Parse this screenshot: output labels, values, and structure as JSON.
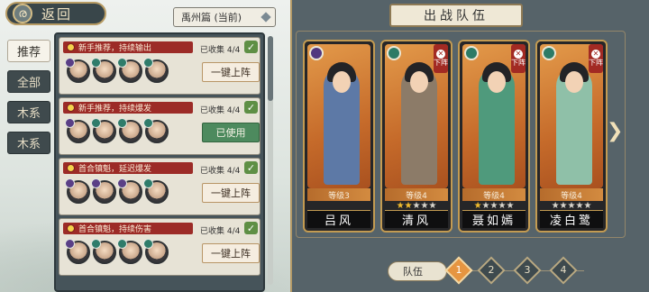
{
  "topbar": {
    "back_label": "返回",
    "chapter": "禹州篇 (当前)"
  },
  "tabs": [
    {
      "label": "推荐",
      "active": true
    },
    {
      "label": "全部",
      "active": false
    },
    {
      "label": "木系",
      "active": false
    },
    {
      "label": "木系",
      "active": false
    }
  ],
  "teams": [
    {
      "tag": "新手推荐，持续输出",
      "collected": "已收集 4/4",
      "button": "一键上阵",
      "used": false
    },
    {
      "tag": "新手推荐，持续爆发",
      "collected": "已收集 4/4",
      "button": "已使用",
      "used": true
    },
    {
      "tag": "首合镇魁，延迟爆发",
      "collected": "已收集 4/4",
      "button": "一键上阵",
      "used": false
    },
    {
      "tag": "首合镇魁，持续伤害",
      "collected": "已收集 4/4",
      "button": "一键上阵",
      "used": false
    }
  ],
  "lineup": {
    "title": "出战队伍",
    "heroes": [
      {
        "name": "吕风",
        "level": "等级3",
        "stars": 0,
        "removable": false,
        "element": "dark"
      },
      {
        "name": "清风",
        "level": "等级4",
        "stars": 2,
        "removable": true,
        "element": "wood",
        "remove_label": "下阵"
      },
      {
        "name": "聂如嫣",
        "level": "等级4",
        "stars": 1,
        "removable": true,
        "element": "wood",
        "remove_label": "下阵"
      },
      {
        "name": "凌白鹭",
        "level": "等级4",
        "stars": 0,
        "removable": true,
        "element": "wood",
        "remove_label": "下阵"
      }
    ]
  },
  "squad": {
    "label": "队伍",
    "slots": [
      "1",
      "2",
      "3",
      "4"
    ],
    "active": "1"
  },
  "colors": {
    "accent": "#9c2b27",
    "gold": "#c39b52",
    "panel": "#46545a",
    "used": "#4d8a5e"
  }
}
